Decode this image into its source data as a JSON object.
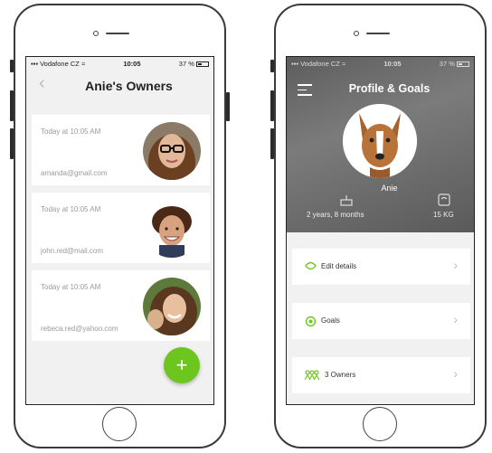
{
  "left_phone": {
    "status": {
      "carrier": "Vodafone CZ",
      "time": "10:05",
      "battery": "37 %"
    },
    "title": "Anie's Owners",
    "owners": [
      {
        "time": "Today at 10:05 AM",
        "email": "amanda@gmail.com"
      },
      {
        "time": "Today at 10:05 AM",
        "email": "john.red@mail.com"
      },
      {
        "time": "Today at 10:05 AM",
        "email": "rebeca.red@yahoo.com"
      }
    ],
    "fab_label": "+"
  },
  "right_phone": {
    "status": {
      "carrier": "Vodafone CZ",
      "time": "10:05",
      "battery": "37 %"
    },
    "title": "Profile & Goals",
    "dog_name": "Anie",
    "age": "2 years, 8 months",
    "weight": "15 KG",
    "menu": [
      {
        "label": "Edit details",
        "icon": "edit-icon"
      },
      {
        "label": "Goals",
        "icon": "goals-icon"
      },
      {
        "label": "3 Owners",
        "icon": "owners-icon"
      }
    ]
  },
  "colors": {
    "accent": "#6cc61e"
  }
}
